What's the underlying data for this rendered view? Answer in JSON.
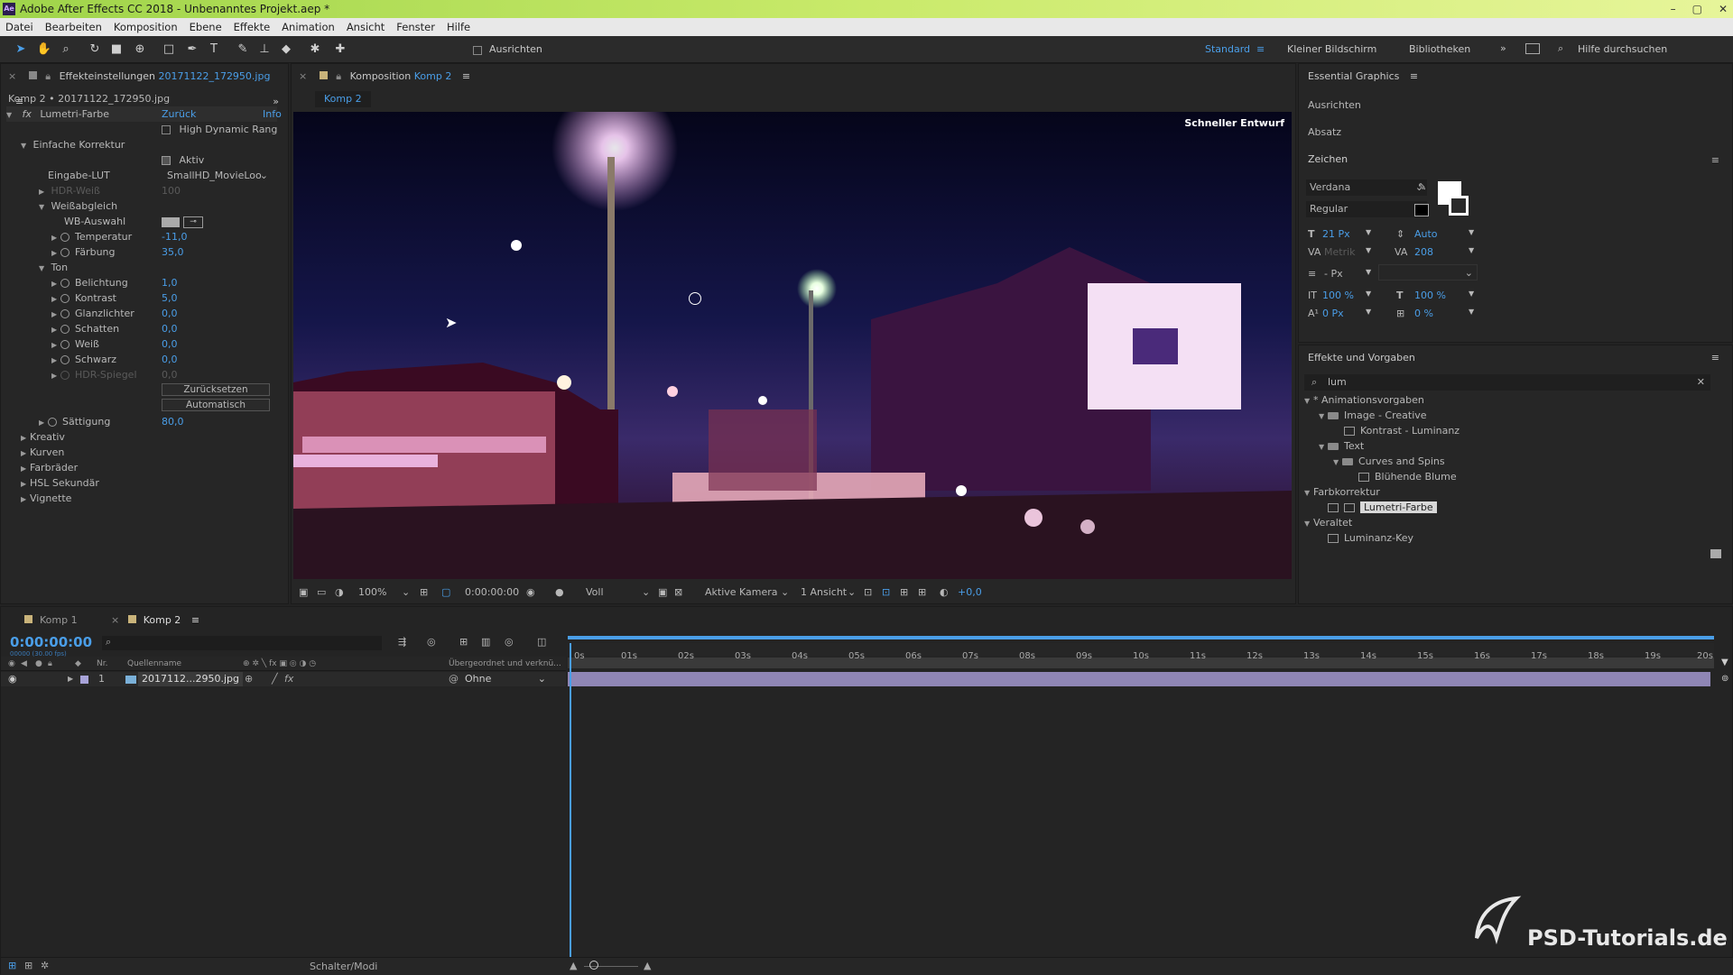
{
  "window": {
    "title": "Adobe After Effects CC 2018 - Unbenanntes Projekt.aep *",
    "app_badge": "Ae",
    "controls": [
      "–",
      "▢",
      "✕"
    ]
  },
  "menu": [
    "Datei",
    "Bearbeiten",
    "Komposition",
    "Ebene",
    "Effekte",
    "Animation",
    "Ansicht",
    "Fenster",
    "Hilfe"
  ],
  "toolbar": {
    "align_label": "Ausrichten",
    "workspaces": [
      "Standard",
      "Kleiner Bildschirm",
      "Bibliotheken"
    ],
    "more": "»",
    "search_placeholder": "Hilfe durchsuchen"
  },
  "effects_panel": {
    "tab_label": "Effekteinstellungen",
    "tab_file": "20171122_172950.jpg",
    "breadcrumb": "Komp 2 • 20171122_172950.jpg",
    "effect_name": "Lumetri-Farbe",
    "back_label": "Zurück",
    "info_label": "Info",
    "hdr_label": "High Dynamic Rang",
    "section_basic": "Einfache Korrektur",
    "active_label": "Aktiv",
    "input_lut_label": "Eingabe-LUT",
    "input_lut_value": "SmallHD_MovieLoo",
    "hdr_white_label": "HDR-Weiß",
    "hdr_white_value": "100",
    "wb_label": "Weißabgleich",
    "wb_select_label": "WB-Auswahl",
    "temperature_label": "Temperatur",
    "temperature_value": "-11,0",
    "tint_label": "Färbung",
    "tint_value": "35,0",
    "tone_label": "Ton",
    "exposure_label": "Belichtung",
    "exposure_value": "1,0",
    "contrast_label": "Kontrast",
    "contrast_value": "5,0",
    "highlights_label": "Glanzlichter",
    "highlights_value": "0,0",
    "shadows_label": "Schatten",
    "shadows_value": "0,0",
    "white_label": "Weiß",
    "white_value": "0,0",
    "black_label": "Schwarz",
    "black_value": "0,0",
    "hdr_mirror_label": "HDR-Spiegel",
    "hdr_mirror_value": "0,0",
    "reset_button": "Zurücksetzen",
    "auto_button": "Automatisch",
    "saturation_label": "Sättigung",
    "saturation_value": "80,0",
    "sections": [
      "Kreativ",
      "Kurven",
      "Farbräder",
      "HSL Sekundär",
      "Vignette"
    ]
  },
  "composition_panel": {
    "tab_label": "Komposition",
    "tab_name": "Komp 2",
    "subtab": "Komp 2",
    "draft_label": "Schneller Entwurf",
    "zoom": "100%",
    "timecode": "0:00:00:00",
    "resolution": "Voll",
    "camera": "Aktive Kamera",
    "views": "1 Ansicht",
    "exposure": "+0,0"
  },
  "essential_graphics": {
    "title": "Essential Graphics",
    "align": "Ausrichten",
    "paragraph": "Absatz",
    "character": "Zeichen",
    "font": "Verdana",
    "style": "Regular",
    "font_size": "21 Px",
    "leading": "Auto",
    "kerning": "Metrik",
    "tracking": "208",
    "stroke_unit": "- Px",
    "vscale": "100 %",
    "hscale": "100 %",
    "baseline": "0 Px",
    "tsume": "0 %"
  },
  "effects_presets": {
    "title": "Effekte und Vorgaben",
    "search_value": "lum",
    "tree": [
      {
        "label": "* Animationsvorgaben",
        "level": 0,
        "kind": "group"
      },
      {
        "label": "Image - Creative",
        "level": 1,
        "kind": "folder"
      },
      {
        "label": "Kontrast - Luminanz",
        "level": 2,
        "kind": "item"
      },
      {
        "label": "Text",
        "level": 1,
        "kind": "folder"
      },
      {
        "label": "Curves and Spins",
        "level": 2,
        "kind": "folder"
      },
      {
        "label": "Blühende Blume",
        "level": 3,
        "kind": "item"
      },
      {
        "label": "Farbkorrektur",
        "level": 0,
        "kind": "group"
      },
      {
        "label": "Lumetri-Farbe",
        "level": 1,
        "kind": "item",
        "selected": true
      },
      {
        "label": "Veraltet",
        "level": 0,
        "kind": "group"
      },
      {
        "label": "Luminanz-Key",
        "level": 1,
        "kind": "item"
      }
    ]
  },
  "timeline": {
    "tabs": [
      "Komp 1",
      "Komp 2"
    ],
    "timecode": "0:00:00:00",
    "fps_note": "00000 (30.00 fps)",
    "col_nr": "Nr.",
    "col_source": "Quellenname",
    "col_parent": "Übergeordnet und verknü...",
    "layer_num": "1",
    "layer_name": "2017112...2950.jpg",
    "parent_value": "Ohne",
    "ticks": [
      "0s",
      "01s",
      "02s",
      "03s",
      "04s",
      "05s",
      "06s",
      "07s",
      "08s",
      "09s",
      "10s",
      "11s",
      "12s",
      "13s",
      "14s",
      "15s",
      "16s",
      "17s",
      "18s",
      "19s",
      "20s"
    ],
    "switches_label": "Schalter/Modi"
  },
  "watermark": "PSD-Tutorials.de",
  "colors": {
    "accent": "#4a9ee8",
    "title_green": "#a8d94f",
    "panel": "#262626",
    "layer_bar": "#8f86b5"
  }
}
